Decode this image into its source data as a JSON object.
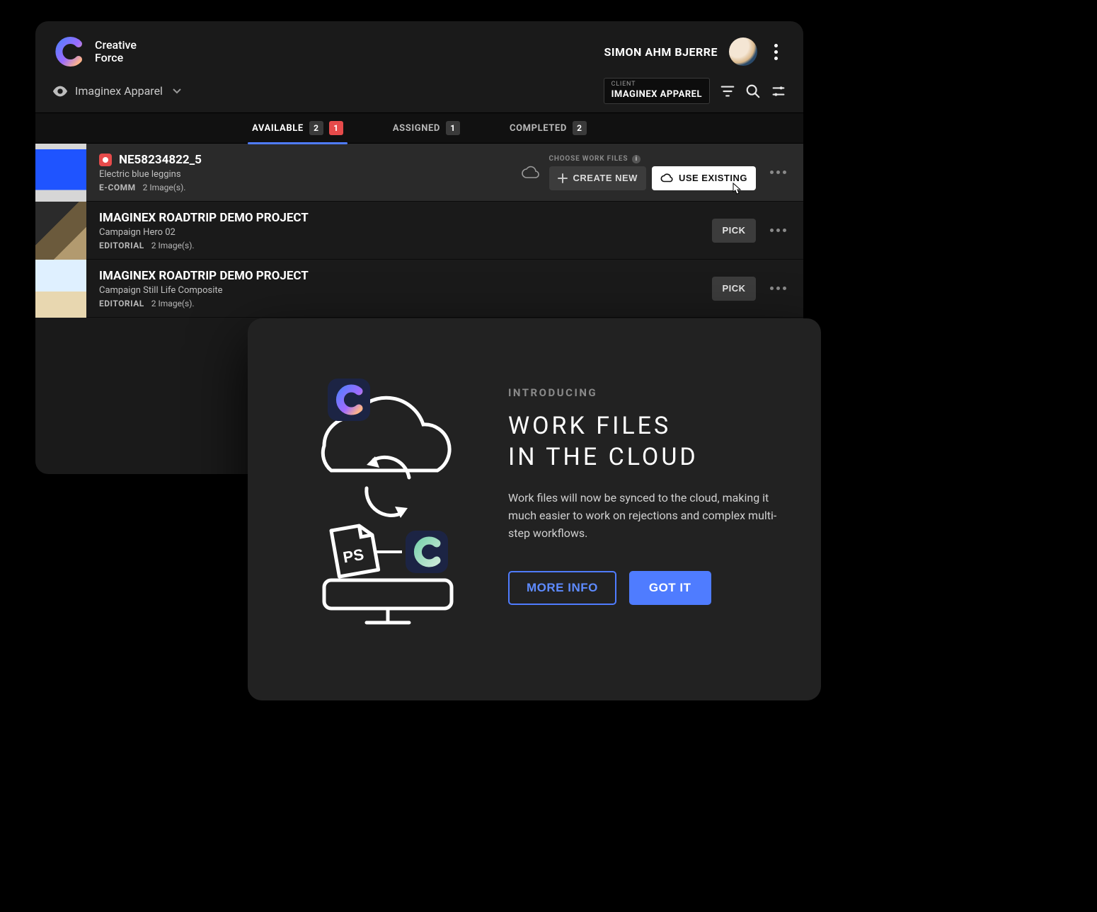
{
  "brand": {
    "line1": "Creative",
    "line2": "Force"
  },
  "user": {
    "name": "SIMON AHM BJERRE"
  },
  "org": {
    "name": "Imaginex Apparel"
  },
  "client_pill": {
    "label": "CLIENT",
    "value": "IMAGINEX APPAREL"
  },
  "tabs": {
    "available": {
      "label": "AVAILABLE",
      "count": "2",
      "alert": "1"
    },
    "assigned": {
      "label": "ASSIGNED",
      "count": "1"
    },
    "completed": {
      "label": "COMPLETED",
      "count": "2"
    }
  },
  "choose_files": {
    "label": "CHOOSE WORK FILES",
    "create_new": "CREATE NEW",
    "use_existing": "USE EXISTING"
  },
  "rows": [
    {
      "title": "NE58234822_5",
      "subtitle": "Electric blue leggins",
      "tag": "E-COMM",
      "meta": "2 Image(s)."
    },
    {
      "title": "IMAGINEX ROADTRIP DEMO PROJECT",
      "subtitle": "Campaign Hero 02",
      "tag": "EDITORIAL",
      "meta": "2 Image(s)."
    },
    {
      "title": "IMAGINEX ROADTRIP DEMO PROJECT",
      "subtitle": "Campaign Still Life Composite",
      "tag": "EDITORIAL",
      "meta": "2 Image(s)."
    }
  ],
  "pick_label": "PICK",
  "modal": {
    "kicker": "INTRODUCING",
    "title_l1": "WORK FILES",
    "title_l2": "IN THE CLOUD",
    "desc": "Work files will now be synced to the cloud, making it much easier to work on rejections and complex multi-step workflows.",
    "more_info": "MORE INFO",
    "got_it": "GOT IT"
  }
}
